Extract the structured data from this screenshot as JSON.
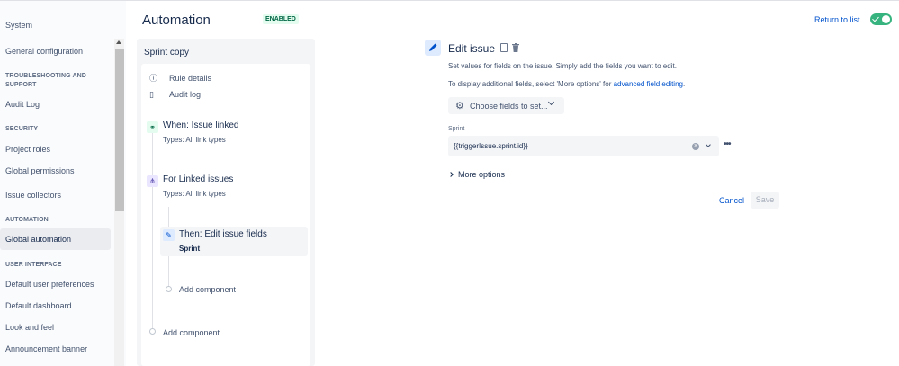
{
  "sidebar": {
    "system": "System",
    "items": [
      {
        "label": "General configuration"
      },
      {
        "label": "Audit Log"
      },
      {
        "label": "Project roles"
      },
      {
        "label": "Global permissions"
      },
      {
        "label": "Issue collectors"
      },
      {
        "label": "Global automation"
      },
      {
        "label": "Default user preferences"
      },
      {
        "label": "Default dashboard"
      },
      {
        "label": "Look and feel"
      },
      {
        "label": "Announcement banner"
      }
    ],
    "headings": {
      "troubleshooting": "TROUBLESHOOTING AND SUPPORT",
      "security": "SECURITY",
      "automation": "AUTOMATION",
      "user_interface": "USER INTERFACE"
    }
  },
  "header": {
    "title": "Automation",
    "badge": "ENABLED",
    "return_link": "Return to list"
  },
  "rule": {
    "name": "Sprint copy",
    "rule_details": "Rule details",
    "audit_log": "Audit log",
    "when_title": "When: Issue linked",
    "when_sub": "Types: All link types",
    "for_title": "For Linked issues",
    "for_sub": "Types: All link types",
    "then_title": "Then: Edit issue fields",
    "then_sub": "Sprint",
    "add_component_inner": "Add component",
    "add_component_outer": "Add component"
  },
  "edit": {
    "title": "Edit issue",
    "desc1": "Set values for fields on the issue. Simply add the fields you want to edit.",
    "desc2_prefix": "To display additional fields, select 'More options' for ",
    "desc2_link": "advanced field editing",
    "desc2_suffix": ".",
    "choose_fields": "Choose fields to set...",
    "sprint_label": "Sprint",
    "sprint_value": "{{triggerIssue.sprint.id}}",
    "more_options": "More options",
    "cancel": "Cancel",
    "save": "Save"
  },
  "colors": {
    "accent": "#0052cc",
    "toggle_on": "#36b37e",
    "badge_bg": "#e3fcef",
    "badge_text": "#006644"
  }
}
